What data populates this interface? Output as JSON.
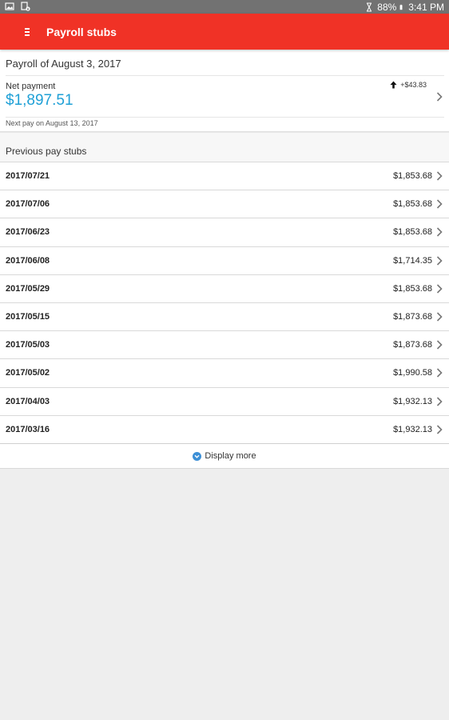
{
  "status_bar": {
    "battery": "88%",
    "time": "3:41 PM",
    "left_icons": [
      "gallery-icon",
      "device-download-icon"
    ],
    "right_icons": [
      "hourglass-icon",
      "battery-icon"
    ]
  },
  "app_bar": {
    "title": "Payroll stubs",
    "menu_icon": "menu-icon",
    "color": "#f03226"
  },
  "current_payroll": {
    "title": "Payroll of August 3, 2017",
    "net_label": "Net payment",
    "net_amount": "$1,897.51",
    "delta": "+$43.83",
    "delta_icon": "arrow-up-icon",
    "next_pay": "Next pay on August 13, 2017",
    "amount_color": "#1fa0d6"
  },
  "previous": {
    "title": "Previous pay stubs",
    "stubs": [
      {
        "date": "2017/07/21",
        "amount": "$1,853.68"
      },
      {
        "date": "2017/07/06",
        "amount": "$1,853.68"
      },
      {
        "date": "2017/06/23",
        "amount": "$1,853.68"
      },
      {
        "date": "2017/06/08",
        "amount": "$1,714.35"
      },
      {
        "date": "2017/05/29",
        "amount": "$1,853.68"
      },
      {
        "date": "2017/05/15",
        "amount": "$1,873.68"
      },
      {
        "date": "2017/05/03",
        "amount": "$1,873.68"
      },
      {
        "date": "2017/05/02",
        "amount": "$1,990.58"
      },
      {
        "date": "2017/04/03",
        "amount": "$1,932.13"
      },
      {
        "date": "2017/03/16",
        "amount": "$1,932.13"
      }
    ]
  },
  "display_more": {
    "label": "Display more",
    "icon": "chevron-down-circle-icon"
  }
}
